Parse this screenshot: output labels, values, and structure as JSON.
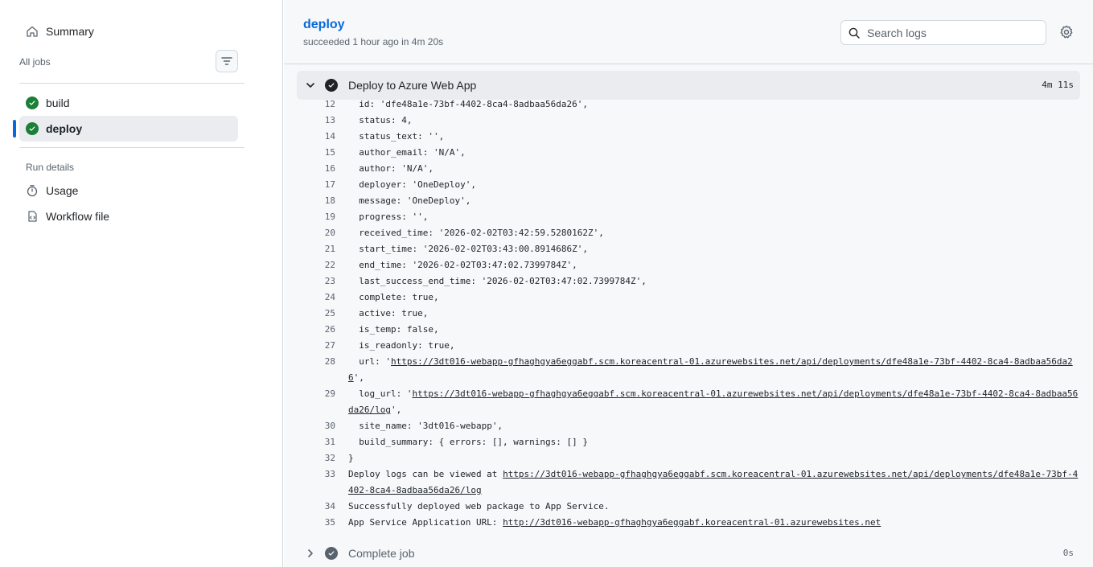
{
  "sidebar": {
    "summary_label": "Summary",
    "all_jobs_label": "All jobs",
    "jobs": [
      {
        "label": "build",
        "status": "success"
      },
      {
        "label": "deploy",
        "status": "success",
        "selected": true
      }
    ],
    "run_details_label": "Run details",
    "usage_label": "Usage",
    "workflow_file_label": "Workflow file"
  },
  "header": {
    "job_title": "deploy",
    "job_status": "succeeded 1 hour ago in 4m 20s",
    "search_placeholder": "Search logs"
  },
  "step": {
    "name": "Deploy to Azure Web App",
    "duration": "4m 11s"
  },
  "log_lines": [
    {
      "n": "12",
      "text": "  id: 'dfe48a1e-73bf-4402-8ca4-8adbaa56da26',"
    },
    {
      "n": "13",
      "text": "  status: 4,"
    },
    {
      "n": "14",
      "text": "  status_text: '',"
    },
    {
      "n": "15",
      "text": "  author_email: 'N/A',"
    },
    {
      "n": "16",
      "text": "  author: 'N/A',"
    },
    {
      "n": "17",
      "text": "  deployer: 'OneDeploy',"
    },
    {
      "n": "18",
      "text": "  message: 'OneDeploy',"
    },
    {
      "n": "19",
      "text": "  progress: '',"
    },
    {
      "n": "20",
      "text": "  received_time: '2026-02-02T03:42:59.5280162Z',"
    },
    {
      "n": "21",
      "text": "  start_time: '2026-02-02T03:43:00.8914686Z',"
    },
    {
      "n": "22",
      "text": "  end_time: '2026-02-02T03:47:02.7399784Z',"
    },
    {
      "n": "23",
      "text": "  last_success_end_time: '2026-02-02T03:47:02.7399784Z',"
    },
    {
      "n": "24",
      "text": "  complete: true,"
    },
    {
      "n": "25",
      "text": "  active: true,"
    },
    {
      "n": "26",
      "text": "  is_temp: false,"
    },
    {
      "n": "27",
      "text": "  is_readonly: true,"
    },
    {
      "n": "28",
      "prefix": "  url: '",
      "link": "https://3dt016-webapp-gfhaghgya6eggabf.scm.koreacentral-01.azurewebsites.net/api/deployments/dfe48a1e-73bf-4402-8ca4-8adbaa56da26",
      "suffix": "',"
    },
    {
      "n": "29",
      "prefix": "  log_url: '",
      "link": "https://3dt016-webapp-gfhaghgya6eggabf.scm.koreacentral-01.azurewebsites.net/api/deployments/dfe48a1e-73bf-4402-8ca4-8adbaa56da26/log",
      "suffix": "',"
    },
    {
      "n": "30",
      "text": "  site_name: '3dt016-webapp',"
    },
    {
      "n": "31",
      "text": "  build_summary: { errors: [], warnings: [] }"
    },
    {
      "n": "32",
      "text": "}"
    },
    {
      "n": "33",
      "prefix": "Deploy logs can be viewed at ",
      "link": "https://3dt016-webapp-gfhaghgya6eggabf.scm.koreacentral-01.azurewebsites.net/api/deployments/dfe48a1e-73bf-4402-8ca4-8adbaa56da26/log",
      "suffix": ""
    },
    {
      "n": "34",
      "text": "Successfully deployed web package to App Service."
    },
    {
      "n": "35",
      "prefix": "App Service Application URL: ",
      "link": "http://3dt016-webapp-gfhaghgya6eggabf.koreacentral-01.azurewebsites.net",
      "suffix": ""
    }
  ],
  "next_step": {
    "name": "Complete job",
    "duration": "0s"
  },
  "colors": {
    "accent": "#0969da",
    "success": "#1a7f37"
  }
}
